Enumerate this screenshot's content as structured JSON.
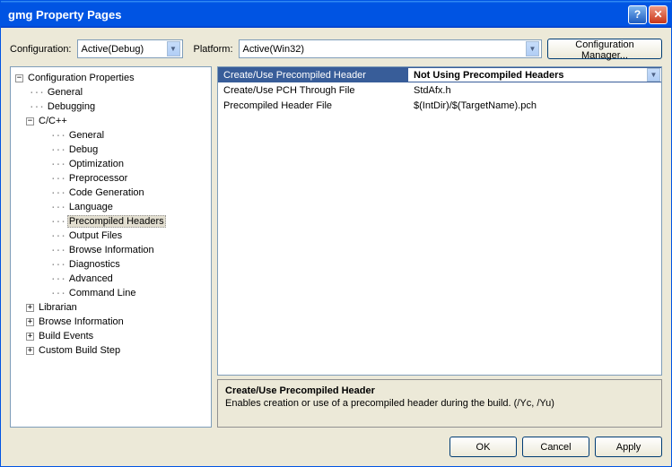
{
  "title": "gmg Property Pages",
  "toolbar": {
    "config_label": "Configuration:",
    "config_value": "Active(Debug)",
    "platform_label": "Platform:",
    "platform_value": "Active(Win32)",
    "config_mgr_label": "Configuration Manager..."
  },
  "tree": {
    "root": "Configuration Properties",
    "general": "General",
    "debugging": "Debugging",
    "cpp": "C/C++",
    "cpp_children": {
      "general": "General",
      "debug": "Debug",
      "optimization": "Optimization",
      "preprocessor": "Preprocessor",
      "codegen": "Code Generation",
      "language": "Language",
      "precompiled": "Precompiled Headers",
      "output": "Output Files",
      "browse": "Browse Information",
      "diagnostics": "Diagnostics",
      "advanced": "Advanced",
      "cmdline": "Command Line"
    },
    "librarian": "Librarian",
    "browseinfo": "Browse Information",
    "buildevents": "Build Events",
    "custom": "Custom Build Step"
  },
  "props": [
    {
      "name": "Create/Use Precompiled Header",
      "value": "Not Using Precompiled Headers"
    },
    {
      "name": "Create/Use PCH Through File",
      "value": "StdAfx.h"
    },
    {
      "name": "Precompiled Header File",
      "value": "$(IntDir)/$(TargetName).pch"
    }
  ],
  "desc": {
    "title": "Create/Use Precompiled Header",
    "body": "Enables creation or use of a precompiled header during the build.     (/Yc, /Yu)"
  },
  "buttons": {
    "ok": "OK",
    "cancel": "Cancel",
    "apply": "Apply"
  }
}
